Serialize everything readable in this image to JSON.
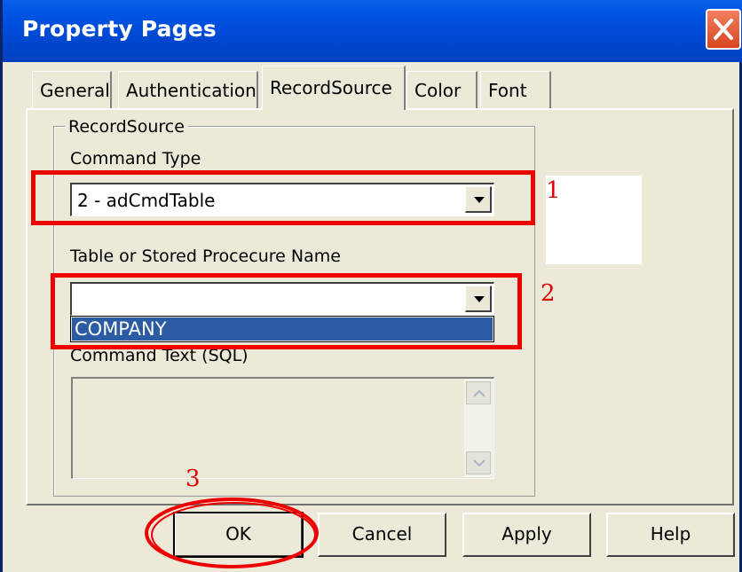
{
  "window": {
    "title": "Property Pages"
  },
  "tabs": [
    {
      "label": "General"
    },
    {
      "label": "Authentication"
    },
    {
      "label": "RecordSource"
    },
    {
      "label": "Color"
    },
    {
      "label": "Font"
    }
  ],
  "active_tab": "RecordSource",
  "recordsource": {
    "group_title": "RecordSource",
    "command_type_label": "Command Type",
    "command_type_value": "2 - adCmdTable",
    "table_label": "Table or Stored Procecure Name",
    "table_value": "",
    "dropdown_options": [
      "COMPANY"
    ],
    "command_text_label": "Command Text (SQL)",
    "command_text_value": ""
  },
  "annotations": {
    "marker_1": "1",
    "marker_2": "2",
    "marker_3": "3"
  },
  "buttons": {
    "ok": "OK",
    "cancel": "Cancel",
    "apply": "Apply",
    "help": "Help"
  },
  "icons": [
    "close-icon",
    "dropdown-arrow-icon",
    "scroll-up-icon",
    "scroll-down-icon"
  ],
  "colors": {
    "titlebar": "#0050dc",
    "annotation_red": "#ee0000",
    "selection": "#2a5ba3",
    "face": "#ece9d8"
  }
}
